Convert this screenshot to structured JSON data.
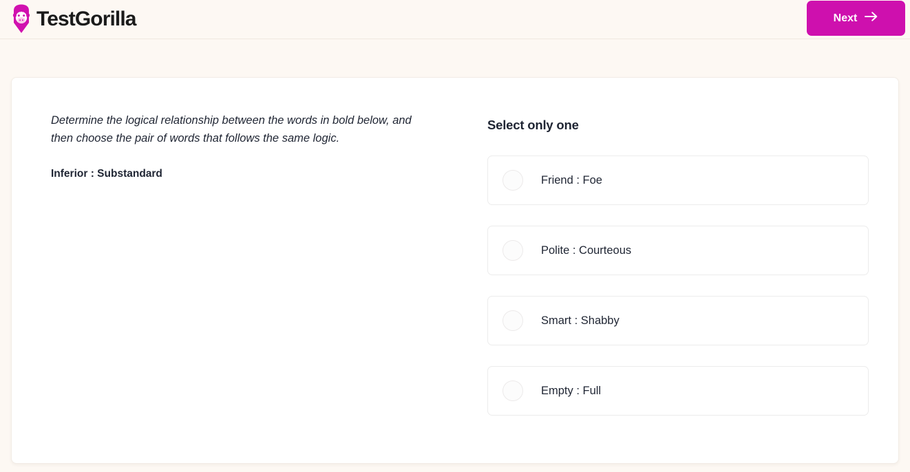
{
  "header": {
    "brand_name": "TestGorilla",
    "brand_icon": "gorilla-logo-icon",
    "next_label": "Next",
    "next_icon": "arrow-right-icon",
    "accent_color": "#ce10ae",
    "background_color": "#fdf8f3"
  },
  "question": {
    "prompt": "Determine the logical relationship between the words in bold below, and then choose the pair of words that follows the same logic.",
    "pair": "Inferior : Substandard"
  },
  "answers": {
    "title": "Select only one",
    "options": [
      {
        "label": "Friend : Foe",
        "selected": false
      },
      {
        "label": "Polite : Courteous",
        "selected": false
      },
      {
        "label": "Smart : Shabby",
        "selected": false
      },
      {
        "label": "Empty : Full",
        "selected": false
      }
    ]
  }
}
